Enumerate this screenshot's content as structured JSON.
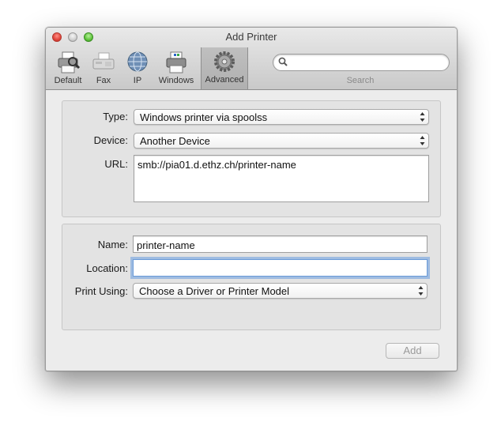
{
  "window": {
    "title": "Add Printer"
  },
  "toolbar": {
    "items": [
      {
        "label": "Default",
        "icon": "printer-magnifier-icon"
      },
      {
        "label": "Fax",
        "icon": "fax-icon"
      },
      {
        "label": "IP",
        "icon": "globe-icon"
      },
      {
        "label": "Windows",
        "icon": "windows-printer-icon"
      },
      {
        "label": "Advanced",
        "icon": "gear-icon",
        "selected": true
      }
    ],
    "search": {
      "placeholder": "",
      "value": "",
      "label": "Search"
    }
  },
  "connection": {
    "type_label": "Type:",
    "type_value": "Windows printer via spoolss",
    "device_label": "Device:",
    "device_value": "Another Device",
    "url_label": "URL:",
    "url_value": "smb://pia01.d.ethz.ch/printer-name"
  },
  "details": {
    "name_label": "Name:",
    "name_value": "printer-name",
    "location_label": "Location:",
    "location_value": "",
    "print_using_label": "Print Using:",
    "print_using_value": "Choose a Driver or Printer Model"
  },
  "footer": {
    "add_label": "Add",
    "add_enabled": false
  },
  "colors": {
    "focus_ring": "#6a9bd8",
    "close": "#e0443a",
    "maximize": "#5fc43c"
  }
}
